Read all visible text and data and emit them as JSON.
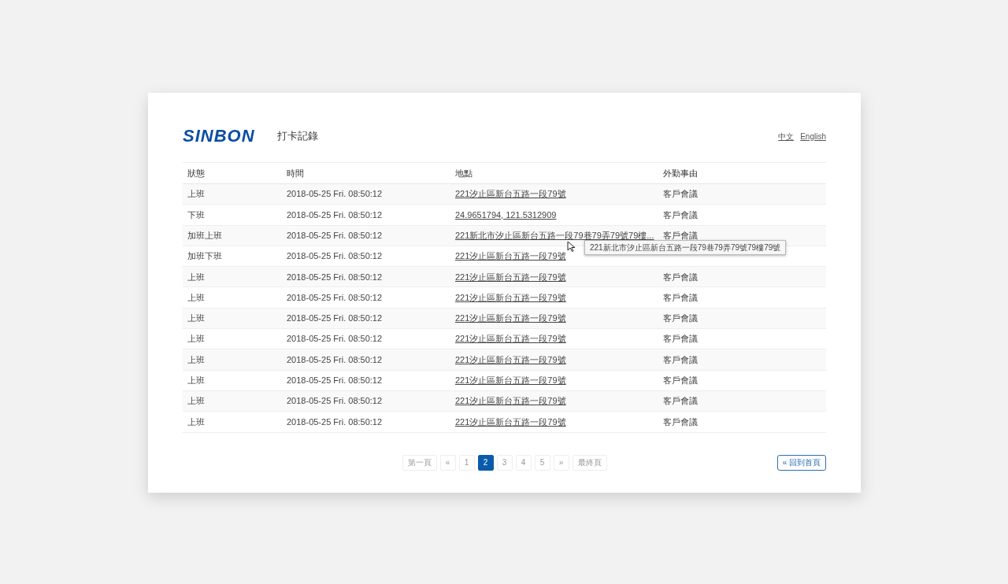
{
  "header": {
    "logo": "SINBON",
    "title": "打卡記錄",
    "languages": [
      {
        "label": "中文"
      },
      {
        "label": "English"
      }
    ]
  },
  "table": {
    "columns": [
      "狀態",
      "時間",
      "地點",
      "外勤事由"
    ],
    "rows": [
      {
        "status": "上班",
        "time": "2018-05-25 Fri. 08:50:12",
        "location": "221汐止區新台五路一段79號",
        "reason": "客戶會議"
      },
      {
        "status": "下班",
        "time": "2018-05-25 Fri. 08:50:12",
        "location": "24.9651794, 121.5312909",
        "reason": "客戶會議"
      },
      {
        "status": "加班上班",
        "time": "2018-05-25 Fri. 08:50:12",
        "location": "221新北市汐止區新台五路一段79巷79弄79號79樓...",
        "reason": "客戶會議",
        "tooltip": "221新北市汐止區新台五路一段79巷79弄79號79樓79號"
      },
      {
        "status": "加班下班",
        "time": "2018-05-25 Fri. 08:50:12",
        "location": "221汐止區新台五路一段79號"
      },
      {
        "status": "上班",
        "time": "2018-05-25 Fri. 08:50:12",
        "location": "221汐止區新台五路一段79號",
        "reason": "客戶會議"
      },
      {
        "status": "上班",
        "time": "2018-05-25 Fri. 08:50:12",
        "location": "221汐止區新台五路一段79號",
        "reason": "客戶會議"
      },
      {
        "status": "上班",
        "time": "2018-05-25 Fri. 08:50:12",
        "location": "221汐止區新台五路一段79號",
        "reason": "客戶會議"
      },
      {
        "status": "上班",
        "time": "2018-05-25 Fri. 08:50:12",
        "location": "221汐止區新台五路一段79號",
        "reason": "客戶會議"
      },
      {
        "status": "上班",
        "time": "2018-05-25 Fri. 08:50:12",
        "location": "221汐止區新台五路一段79號",
        "reason": "客戶會議"
      },
      {
        "status": "上班",
        "time": "2018-05-25 Fri. 08:50:12",
        "location": "221汐止區新台五路一段79號",
        "reason": "客戶會議"
      },
      {
        "status": "上班",
        "time": "2018-05-25 Fri. 08:50:12",
        "location": "221汐止區新台五路一段79號",
        "reason": "客戶會議"
      },
      {
        "status": "上班",
        "time": "2018-05-25 Fri. 08:50:12",
        "location": "221汐止區新台五路一段79號",
        "reason": "客戶會議"
      }
    ]
  },
  "pagination": [
    {
      "label": "第一頁",
      "selected": false
    },
    {
      "label": "«",
      "selected": false
    },
    {
      "label": "1",
      "selected": false
    },
    {
      "label": "2",
      "selected": true
    },
    {
      "label": "3",
      "selected": false
    },
    {
      "label": "4",
      "selected": false
    },
    {
      "label": "5",
      "selected": false
    },
    {
      "label": "»",
      "selected": false
    },
    {
      "label": "最終頁",
      "selected": false
    }
  ],
  "back_button": "« 回到首頁"
}
